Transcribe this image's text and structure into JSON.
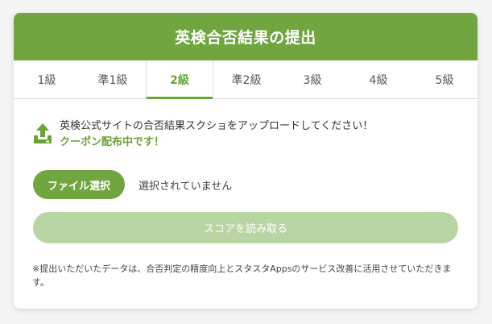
{
  "header": {
    "title": "英検合否結果の提出"
  },
  "tabs": [
    {
      "label": "1級",
      "active": false
    },
    {
      "label": "準1級",
      "active": false
    },
    {
      "label": "2級",
      "active": true
    },
    {
      "label": "準2級",
      "active": false
    },
    {
      "label": "3級",
      "active": false
    },
    {
      "label": "4級",
      "active": false
    },
    {
      "label": "5級",
      "active": false
    }
  ],
  "upload": {
    "icon": "upload-icon",
    "instruction": "英検公式サイトの合否結果スクショをアップロードしてください！",
    "promo": "クーポン配布中です！"
  },
  "file": {
    "button_label": "ファイル選択",
    "status": "選択されていません"
  },
  "read_button": {
    "label": "スコアを読み取る"
  },
  "note": "※提出いただいたデータは、合否判定の精度向上とスタスタAppsのサービス改善に活用させていただきます。",
  "colors": {
    "accent": "#71a53f",
    "accent_text": "#6aa335",
    "disabled_button": "#bad5a4"
  }
}
